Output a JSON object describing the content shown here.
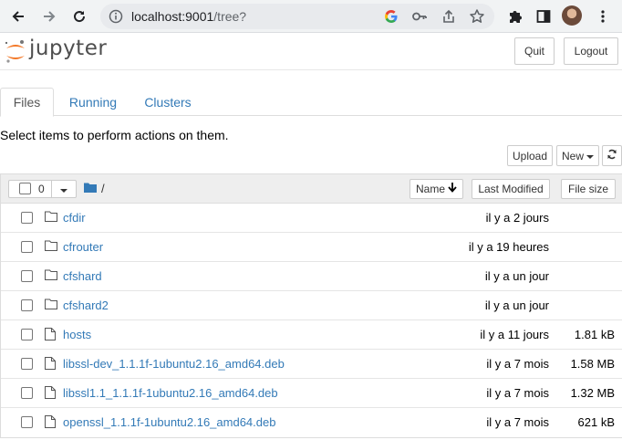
{
  "browser": {
    "url_host": "localhost:9001",
    "url_path": "/tree?"
  },
  "header": {
    "logo_text": "jupyter",
    "quit_label": "Quit",
    "logout_label": "Logout"
  },
  "tabs": [
    {
      "label": "Files",
      "active": true
    },
    {
      "label": "Running",
      "active": false
    },
    {
      "label": "Clusters",
      "active": false
    }
  ],
  "toolbar": {
    "select_message": "Select items to perform actions on them.",
    "upload_label": "Upload",
    "new_label": "New"
  },
  "list_header": {
    "selected_count": "0",
    "path": "/",
    "sort_name_label": "Name",
    "sort_modified_label": "Last Modified",
    "sort_size_label": "File size"
  },
  "files": [
    {
      "type": "folder",
      "name": "cfdir",
      "modified": "il y a 2 jours",
      "size": ""
    },
    {
      "type": "folder",
      "name": "cfrouter",
      "modified": "il y a 19 heures",
      "size": ""
    },
    {
      "type": "folder",
      "name": "cfshard",
      "modified": "il y a un jour",
      "size": ""
    },
    {
      "type": "folder",
      "name": "cfshard2",
      "modified": "il y a un jour",
      "size": ""
    },
    {
      "type": "file",
      "name": "hosts",
      "modified": "il y a 11 jours",
      "size": "1.81 kB"
    },
    {
      "type": "file",
      "name": "libssl-dev_1.1.1f-1ubuntu2.16_amd64.deb",
      "modified": "il y a 7 mois",
      "size": "1.58 MB"
    },
    {
      "type": "file",
      "name": "libssl1.1_1.1.1f-1ubuntu2.16_amd64.deb",
      "modified": "il y a 7 mois",
      "size": "1.32 MB"
    },
    {
      "type": "file",
      "name": "openssl_1.1.1f-1ubuntu2.16_amd64.deb",
      "modified": "il y a 7 mois",
      "size": "621 kB"
    }
  ],
  "colors": {
    "link": "#337ab7",
    "logo_orange": "#f37726"
  }
}
